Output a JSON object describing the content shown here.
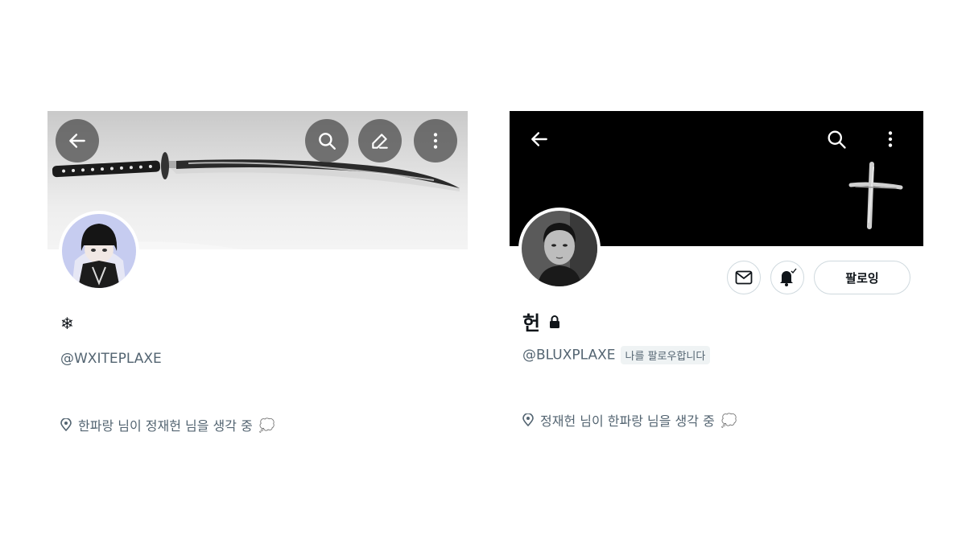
{
  "left_profile": {
    "display_name": "❄",
    "handle": "@WXITEPLAXE",
    "bio_location": "한파랑 님이 정재헌 님을 생각 중",
    "bio_emoji": "💭",
    "icons": {
      "back": "arrow-left-icon",
      "search": "search-icon",
      "edit": "edit-pencil-icon",
      "more": "more-vertical-icon"
    }
  },
  "right_profile": {
    "display_name": "헌",
    "handle": "@BLUXPLAXE",
    "follows_you_badge": "나를 팔로우합니다",
    "bio_location": "정재헌 님이 한파랑 님을 생각 중",
    "bio_emoji": "💭",
    "follow_button_label": "팔로잉",
    "icons": {
      "back": "arrow-left-icon",
      "search": "search-icon",
      "more": "more-vertical-icon",
      "message": "mail-icon",
      "notify": "bell-check-icon",
      "protected": "lock-icon"
    }
  },
  "colors": {
    "secondary_text": "#536471",
    "primary_text": "#0f1419",
    "border": "#cfd9de",
    "badge_bg": "#eff3f4"
  }
}
